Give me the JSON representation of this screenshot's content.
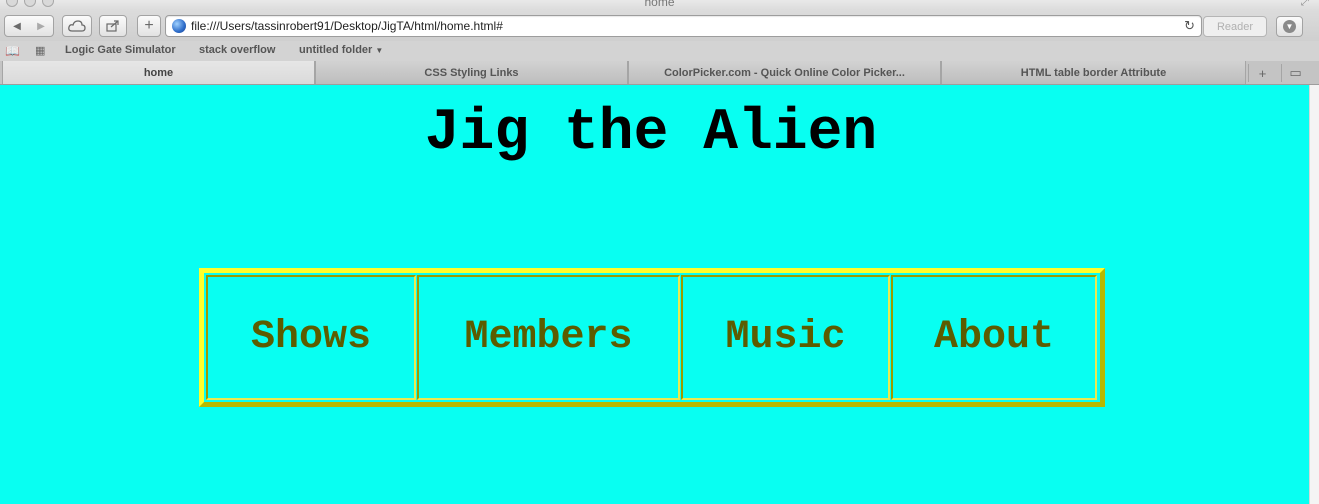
{
  "window": {
    "title": "home"
  },
  "toolbar": {
    "url": "file:///Users/tassinrobert91/Desktop/JigTA/html/home.html#",
    "reader_label": "Reader"
  },
  "bookmarks": [
    "Logic Gate Simulator",
    "stack overflow",
    "untitled folder"
  ],
  "tabs": [
    {
      "label": "home",
      "active": true
    },
    {
      "label": "CSS Styling Links",
      "active": false
    },
    {
      "label": "ColorPicker.com - Quick Online Color Picker...",
      "active": false
    },
    {
      "label": "HTML table border Attribute",
      "active": false
    }
  ],
  "page": {
    "heading": "Jig the Alien",
    "nav": [
      "Shows",
      "Members",
      "Music",
      "About"
    ],
    "colors": {
      "background": "#08fff2",
      "nav_text": "#5c5c00",
      "table_border_light": "#ffff2b",
      "table_border_dark": "#b8b800"
    }
  }
}
